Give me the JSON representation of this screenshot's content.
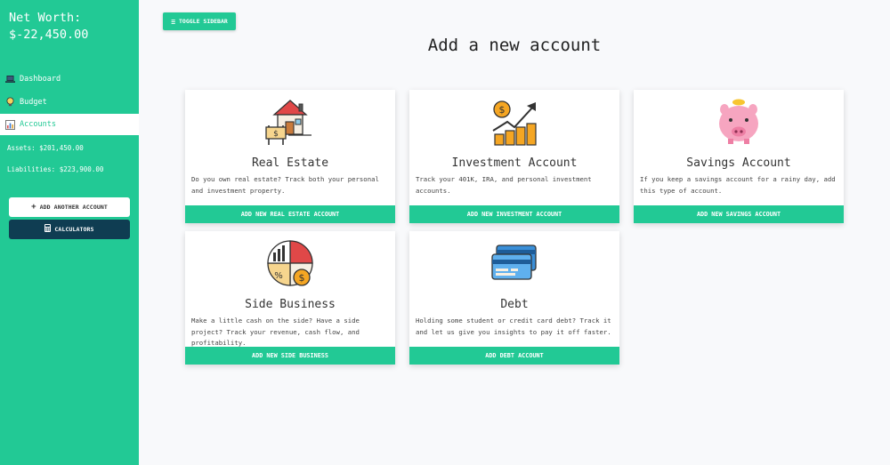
{
  "sidebar": {
    "net_worth_label": "Net Worth:",
    "net_worth_value": "$-22,450.00",
    "nav": [
      {
        "label": "Dashboard",
        "icon": "laptop-icon"
      },
      {
        "label": "Budget",
        "icon": "lightbulb-icon"
      },
      {
        "label": "Accounts",
        "icon": "chart-icon",
        "active": true
      }
    ],
    "assets": "Assets: $201,450.00",
    "liabilities": "Liabilities: $223,900.00",
    "add_account_label": "ADD ANOTHER ACCOUNT",
    "add_account_icon": "+",
    "calculators_label": "CALCULATORS",
    "calculators_icon": "calculator-icon"
  },
  "toolbar": {
    "toggle_label": "TOGGLE SIDEBAR",
    "toggle_icon": "≡"
  },
  "page_title": "Add a new account",
  "cards": [
    {
      "icon": "house-sale-icon",
      "title": "Real Estate",
      "text": "Do you own real estate? Track both your personal and investment property.",
      "button": "ADD NEW REAL ESTATE ACCOUNT"
    },
    {
      "icon": "investment-growth-icon",
      "title": "Investment Account",
      "text": "Track your 401K, IRA, and personal investment accounts.",
      "button": "ADD NEW INVESTMENT ACCOUNT"
    },
    {
      "icon": "piggy-bank-icon",
      "title": "Savings Account",
      "text": "If you keep a savings account for a rainy day, add this type of account.",
      "button": "ADD NEW SAVINGS ACCOUNT"
    },
    {
      "icon": "business-chart-icon",
      "title": "Side Business",
      "text": "Make a little cash on the side? Have a side project? Track your revenue, cash flow, and profitability.",
      "button": "ADD NEW SIDE BUSINESS"
    },
    {
      "icon": "credit-card-icon",
      "title": "Debt",
      "text": "Holding some student or credit card debt? Track it and let us give you insights to pay it off faster.",
      "button": "ADD DEBT ACCOUNT"
    }
  ],
  "colors": {
    "accent": "#22c995",
    "dark": "#0f3d52",
    "background": "#f8f9fb"
  }
}
